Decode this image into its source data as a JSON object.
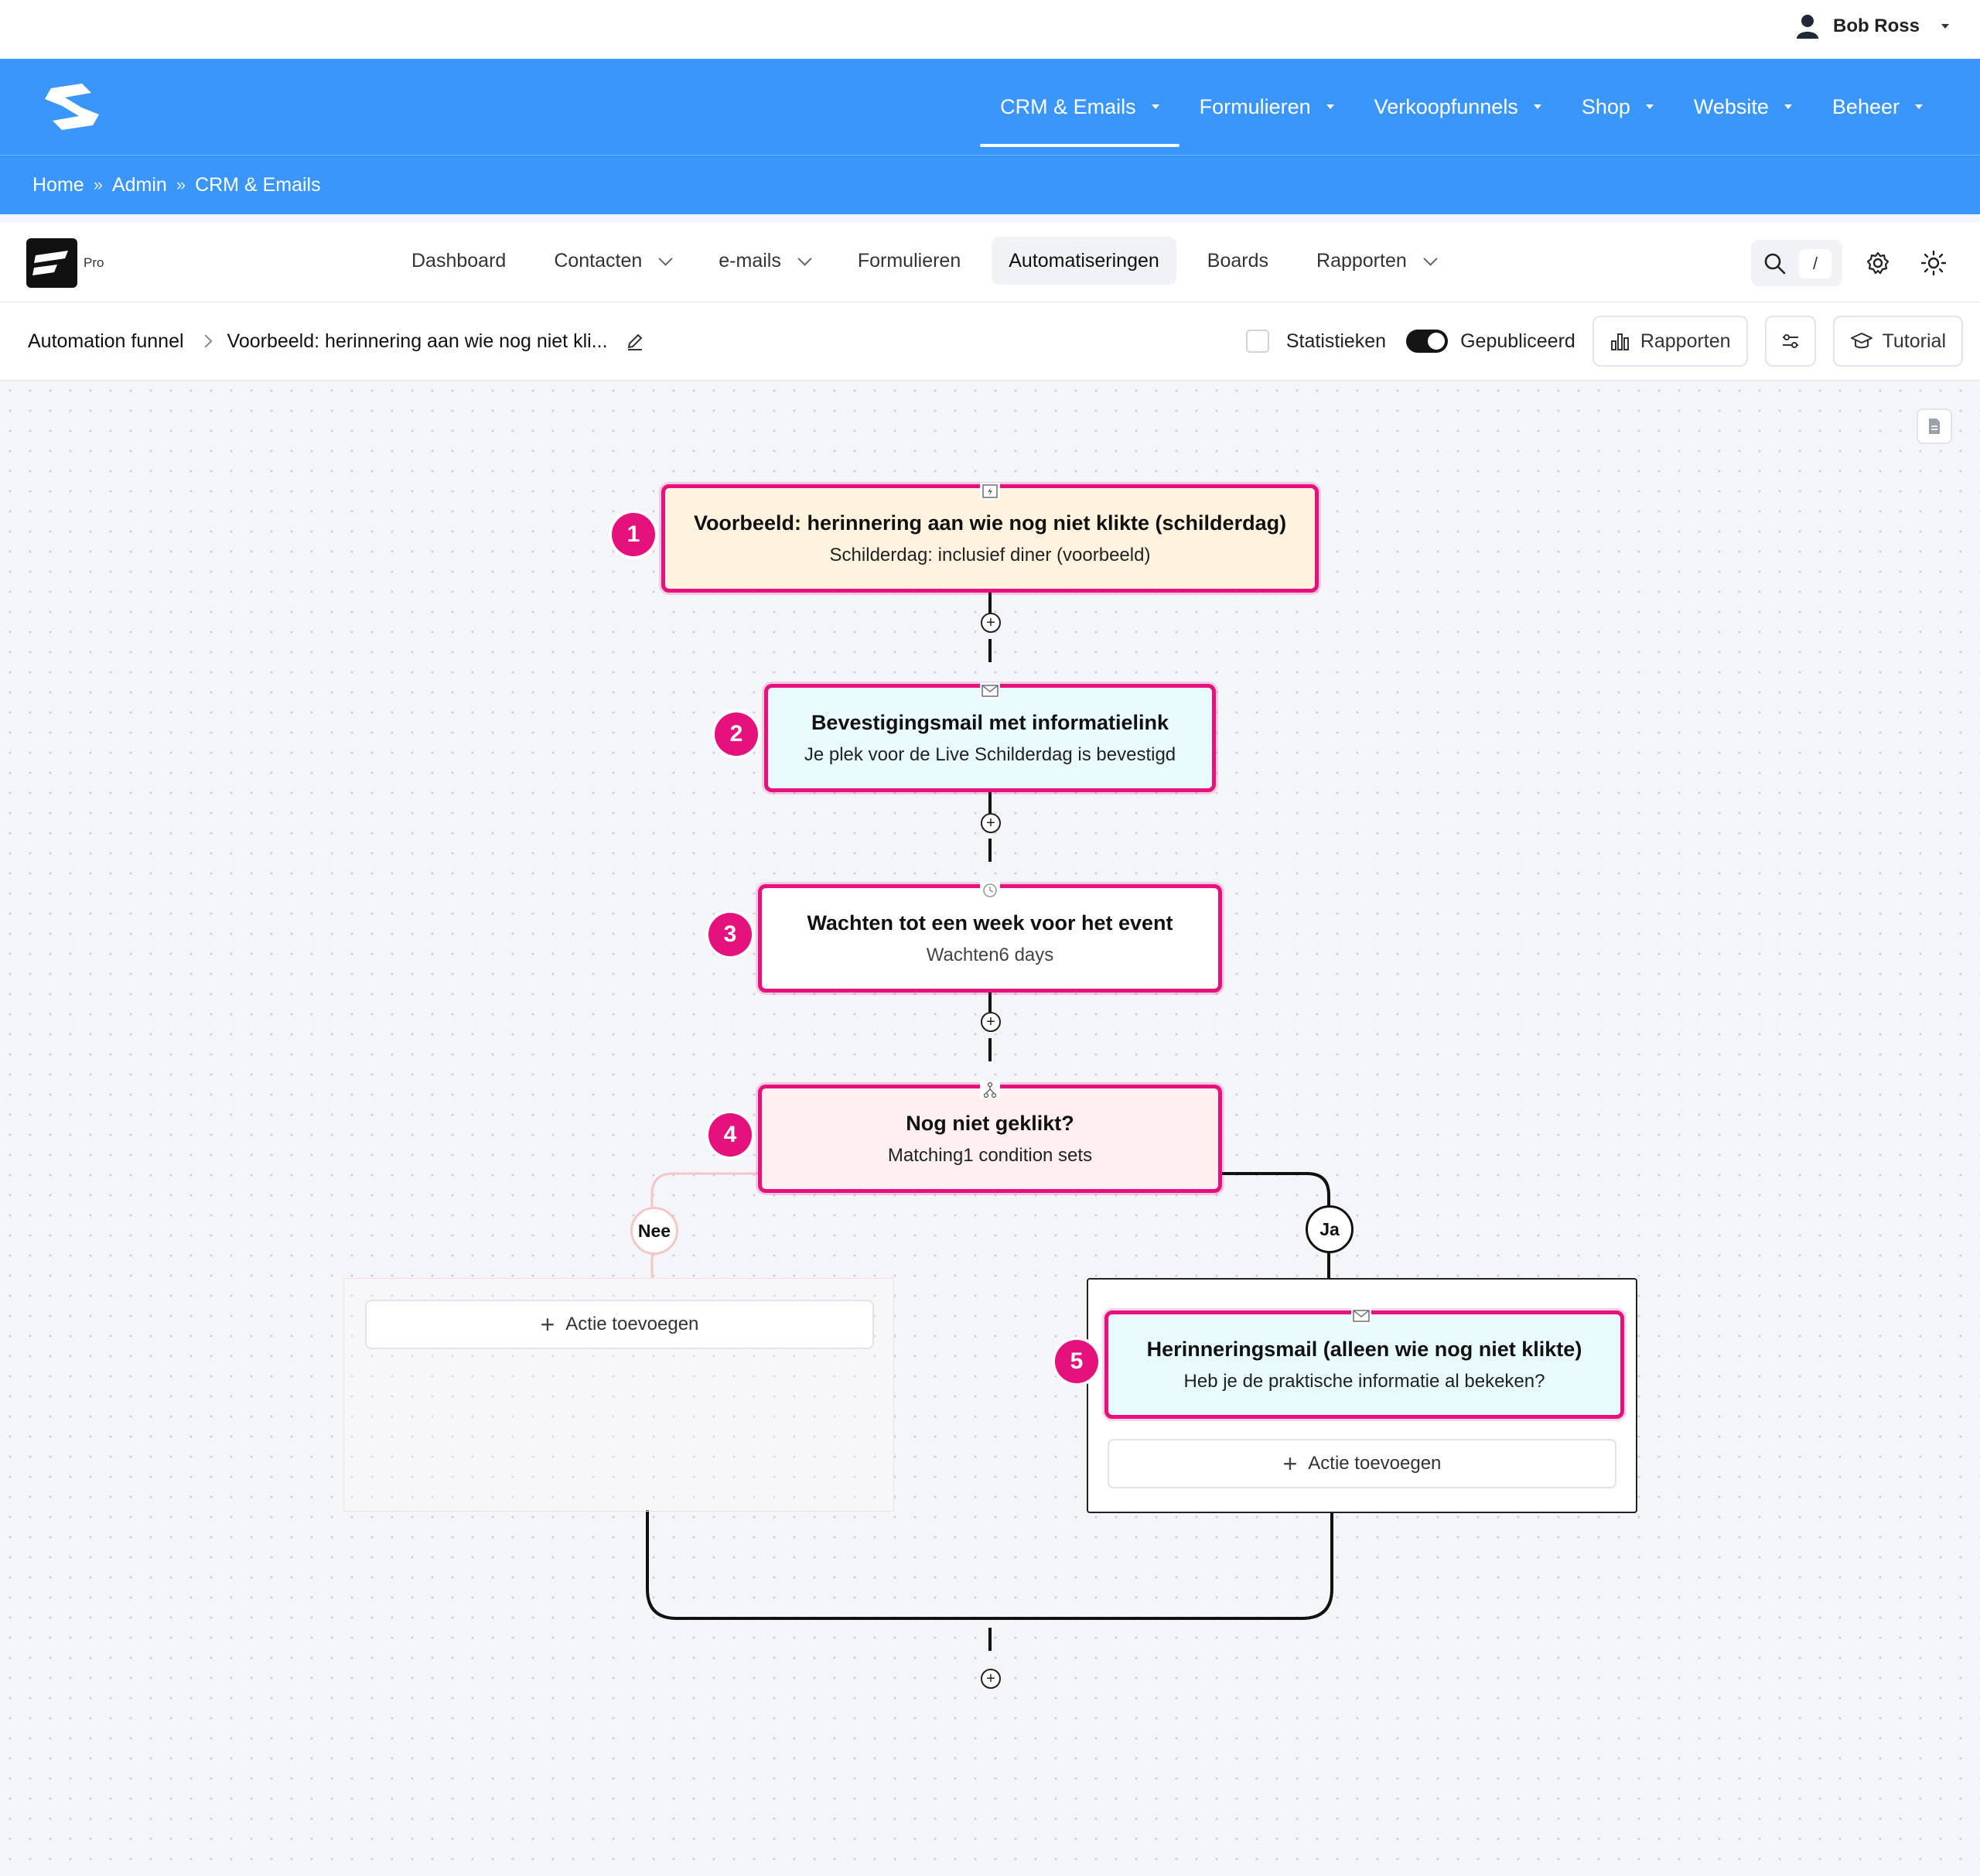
{
  "user": {
    "name": "Bob Ross"
  },
  "main_menu": [
    {
      "label": "CRM & Emails",
      "active": true
    },
    {
      "label": "Formulieren"
    },
    {
      "label": "Verkoopfunnels"
    },
    {
      "label": "Shop"
    },
    {
      "label": "Website"
    },
    {
      "label": "Beheer"
    }
  ],
  "breadcrumb": {
    "home": "Home",
    "admin": "Admin",
    "crm": "CRM & Emails",
    "separator": "»"
  },
  "app": {
    "pro_label": "Pro",
    "nav": [
      {
        "label": "Dashboard"
      },
      {
        "label": "Contacten",
        "dropdown": true
      },
      {
        "label": "e-mails",
        "dropdown": true
      },
      {
        "label": "Formulieren"
      },
      {
        "label": "Automatiseringen",
        "active": true
      },
      {
        "label": "Boards"
      },
      {
        "label": "Rapporten",
        "dropdown": true
      }
    ],
    "search_shortcut": "/"
  },
  "funnel": {
    "root": "Automation funnel",
    "current": "Voorbeeld: herinnering aan wie nog niet kli...",
    "statistics_label": "Statistieken",
    "published_label": "Gepubliceerd",
    "published": true,
    "reports_button": "Rapporten",
    "tutorial_button": "Tutorial"
  },
  "flow": {
    "steps": [
      {
        "number": "1",
        "title": "Voorbeeld: herinnering aan wie nog niet klikte (schilderdag)",
        "subtitle": "Schilderdag: inclusief diner (voorbeeld)",
        "icon": "trigger-icon",
        "bg": "#fff3e0"
      },
      {
        "number": "2",
        "title": "Bevestigingsmail met informatielink",
        "subtitle": "Je plek voor de Live Schilderdag is bevestigd",
        "icon": "mail-icon",
        "bg": "#e8fafb"
      },
      {
        "number": "3",
        "title": "Wachten tot een week voor het event",
        "subtitle": "Wachten6 days",
        "icon": "clock-icon",
        "bg": "#ffffff"
      },
      {
        "number": "4",
        "title": "Nog niet geklikt?",
        "subtitle": "Matching1 condition sets",
        "icon": "branch-icon",
        "bg": "#fff0f0"
      },
      {
        "number": "5",
        "title": "Herinneringsmail (alleen wie nog niet klikte)",
        "subtitle": "Heb je de praktische informatie al bekeken?",
        "icon": "mail-icon",
        "bg": "#e8fafb"
      }
    ],
    "branch_no": "Nee",
    "branch_yes": "Ja",
    "add_action": "Actie toevoegen",
    "colors": {
      "accent": "#e5127d",
      "brand": "#3a96fb"
    }
  }
}
